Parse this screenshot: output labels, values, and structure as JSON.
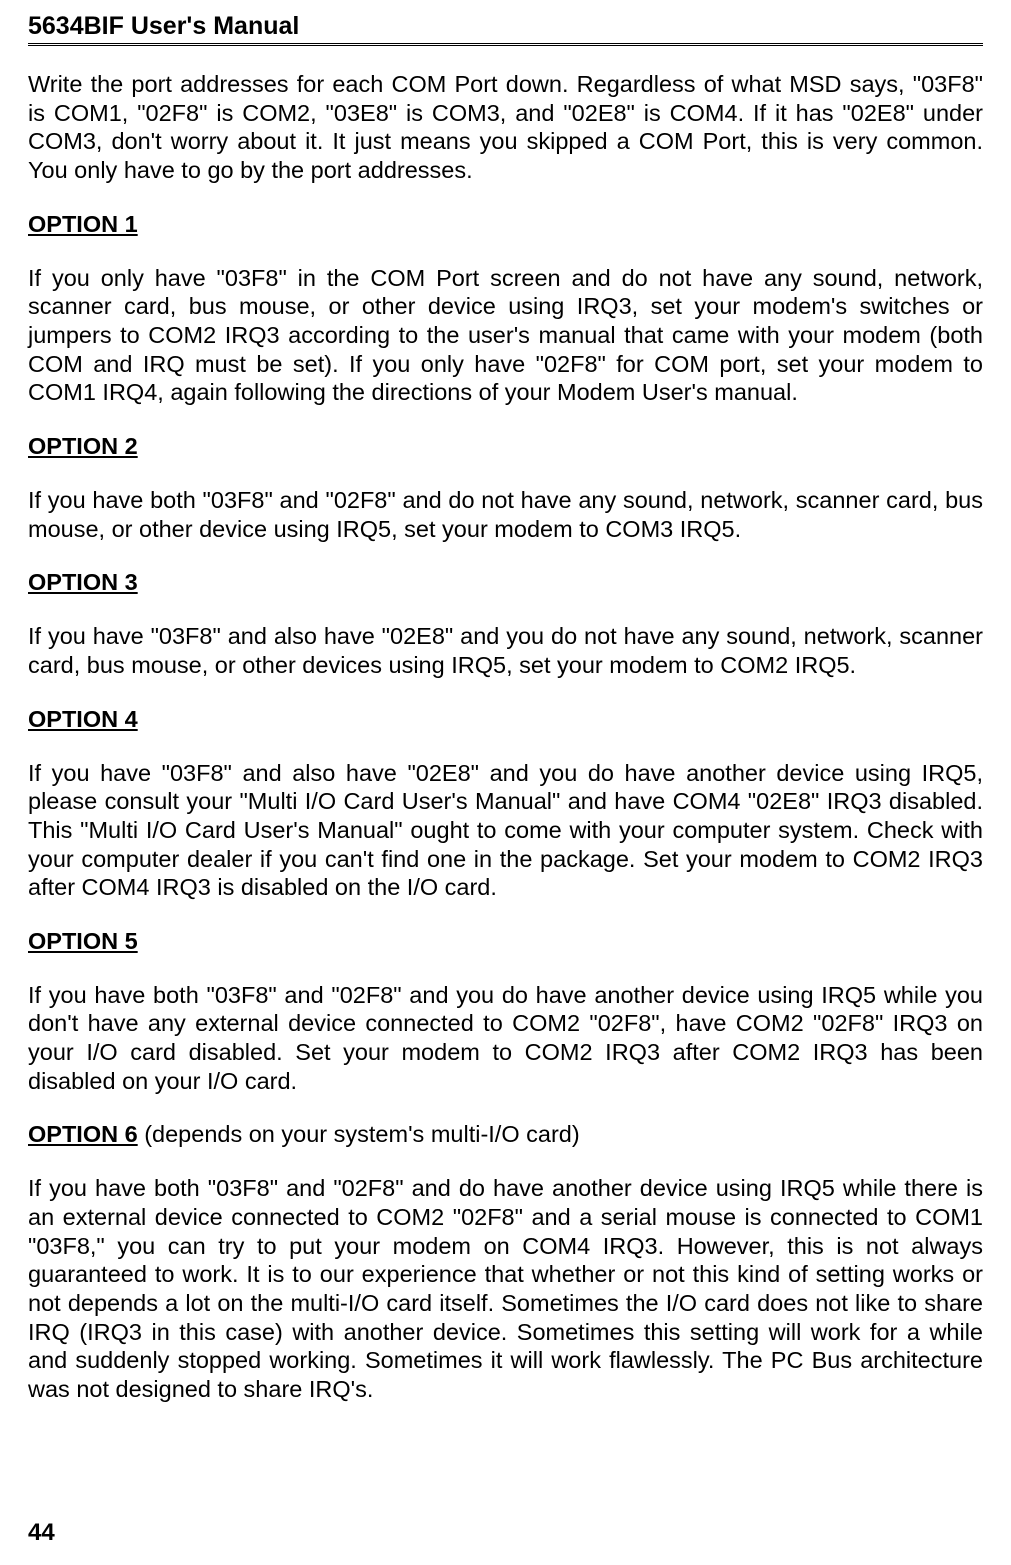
{
  "header": {
    "title": "5634BIF User's Manual"
  },
  "intro": "Write the port addresses for each COM Port down.   Regardless of what MSD says, \"03F8\" is COM1, \"02F8\" is COM2, \"03E8\" is COM3, and \"02E8\" is COM4.    If it has \"02E8\" under COM3, don't worry about it.   It just means you skipped a COM Port, this is very common.   You only have to go by the port addresses.",
  "option1": {
    "heading": "OPTION 1",
    "text": "If you only have \"03F8\" in the COM Port screen and do not have any sound, network, scanner card, bus mouse, or other device using IRQ3, set your modem's switches or jumpers to COM2 IRQ3 according to the user's manual that came with your modem (both COM and IRQ must be set).   If   you only have \"02F8\" for COM port, set your modem to COM1 IRQ4, again following the directions of your Modem User's manual."
  },
  "option2": {
    "heading": "OPTION 2",
    "text": "If you have both \"03F8\" and \"02F8\" and do not have any sound, network, scanner card, bus mouse, or other device using IRQ5, set your modem to COM3 IRQ5."
  },
  "option3": {
    "heading": "OPTION 3",
    "text": "If you have \"03F8\" and also have \"02E8\" and you do not have any sound, network, scanner card, bus mouse, or other devices using IRQ5, set your modem to COM2 IRQ5."
  },
  "option4": {
    "heading": "OPTION 4",
    "text": "If you have \"03F8\" and also have \"02E8\" and you do have another device using IRQ5, please consult your \"Multi I/O Card User's Manual\" and have COM4 \"02E8\" IRQ3 disabled.   This \"Multi I/O Card User's Manual\" ought to come with your computer system. Check with your computer dealer if you can't find one in the package.   Set your modem to COM2 IRQ3 after COM4 IRQ3 is disabled on the I/O card."
  },
  "option5": {
    "heading": "OPTION 5",
    "text": "If you have both \"03F8\" and \"02F8\" and you do have another device using IRQ5 while you don't have any external device connected to COM2 \"02F8\", have COM2 \"02F8\" IRQ3 on your I/O card disabled.   Set your modem to COM2 IRQ3 after COM2 IRQ3 has been disabled on your I/O card."
  },
  "option6": {
    "heading": "OPTION 6",
    "suffix": " (depends on your system's multi-I/O card)",
    "text": "If you have both \"03F8\" and \"02F8\" and do have another device using IRQ5 while there is an external device connected to COM2 \"02F8\" and a serial mouse is connected to COM1 \"03F8,\" you can try to put your modem on COM4 IRQ3.   However, this is not always guaranteed to work.   It is to our experience that whether or not this kind of setting works or not depends a lot on the multi-I/O card itself.   Sometimes the I/O card does not like to share IRQ (IRQ3 in this case) with another device.   Sometimes this setting will work for a while and suddenly stopped working.   Sometimes it will work flawlessly.   The PC Bus architecture was not designed to share IRQ's."
  },
  "page_number": "44"
}
